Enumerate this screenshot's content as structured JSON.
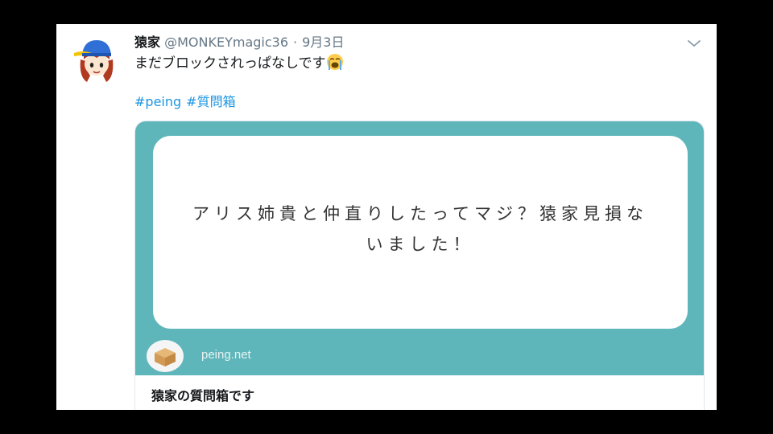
{
  "tweet": {
    "display_name": "猿家",
    "handle": "@MONKEYmagic36",
    "separator": "·",
    "date": "9月3日",
    "text": "まだブロックされっぱなしです",
    "emoji": "loudly-crying-face",
    "hashtags": [
      "#peing",
      "#質問箱"
    ]
  },
  "card": {
    "question_line1": "アリス姉貴と仲直りしたってマジ？猿家見損な",
    "question_line2": "いました！",
    "domain": "peing.net",
    "title": "猿家の質問箱です"
  },
  "colors": {
    "card_teal": "#5fb6ba",
    "hashtag_blue": "#1b95e0",
    "muted_gray": "#657786",
    "text_dark": "#14171a"
  },
  "icons": {
    "avatar": "avatar-cap-character",
    "menu": "chevron-down-icon",
    "card_logo": "cardboard-box-icon"
  }
}
